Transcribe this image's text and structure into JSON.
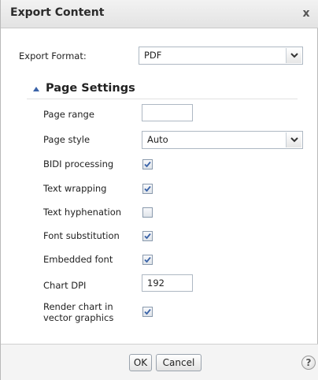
{
  "dialog": {
    "title": "Export Content",
    "close_glyph": "x"
  },
  "export_format": {
    "label": "Export Format:",
    "value": "PDF"
  },
  "page_settings": {
    "title": "Page Settings",
    "page_range": {
      "label": "Page range",
      "value": ""
    },
    "page_style": {
      "label": "Page style",
      "value": "Auto"
    },
    "bidi_processing": {
      "label": "BIDI processing",
      "checked": true
    },
    "text_wrapping": {
      "label": "Text wrapping",
      "checked": true
    },
    "text_hyphenation": {
      "label": "Text hyphenation",
      "checked": false
    },
    "font_substitution": {
      "label": "Font substitution",
      "checked": true
    },
    "embedded_font": {
      "label": "Embedded font",
      "checked": true
    },
    "chart_dpi": {
      "label": "Chart DPI",
      "value": "192"
    },
    "render_chart_vector": {
      "label_line1": "Render chart in",
      "label_line2": "vector graphics",
      "checked": true
    }
  },
  "footer": {
    "ok_label": "OK",
    "cancel_label": "Cancel",
    "help_glyph": "?"
  },
  "icons": {
    "close": "close-icon",
    "dropdown": "chevron-down-icon",
    "section_toggle": "triangle-up-icon",
    "help": "help-icon",
    "check": "checkmark-icon"
  },
  "colors": {
    "check": "#3a63a8",
    "title_bar": "#ebebeb",
    "field_border": "#aeb8c3"
  }
}
